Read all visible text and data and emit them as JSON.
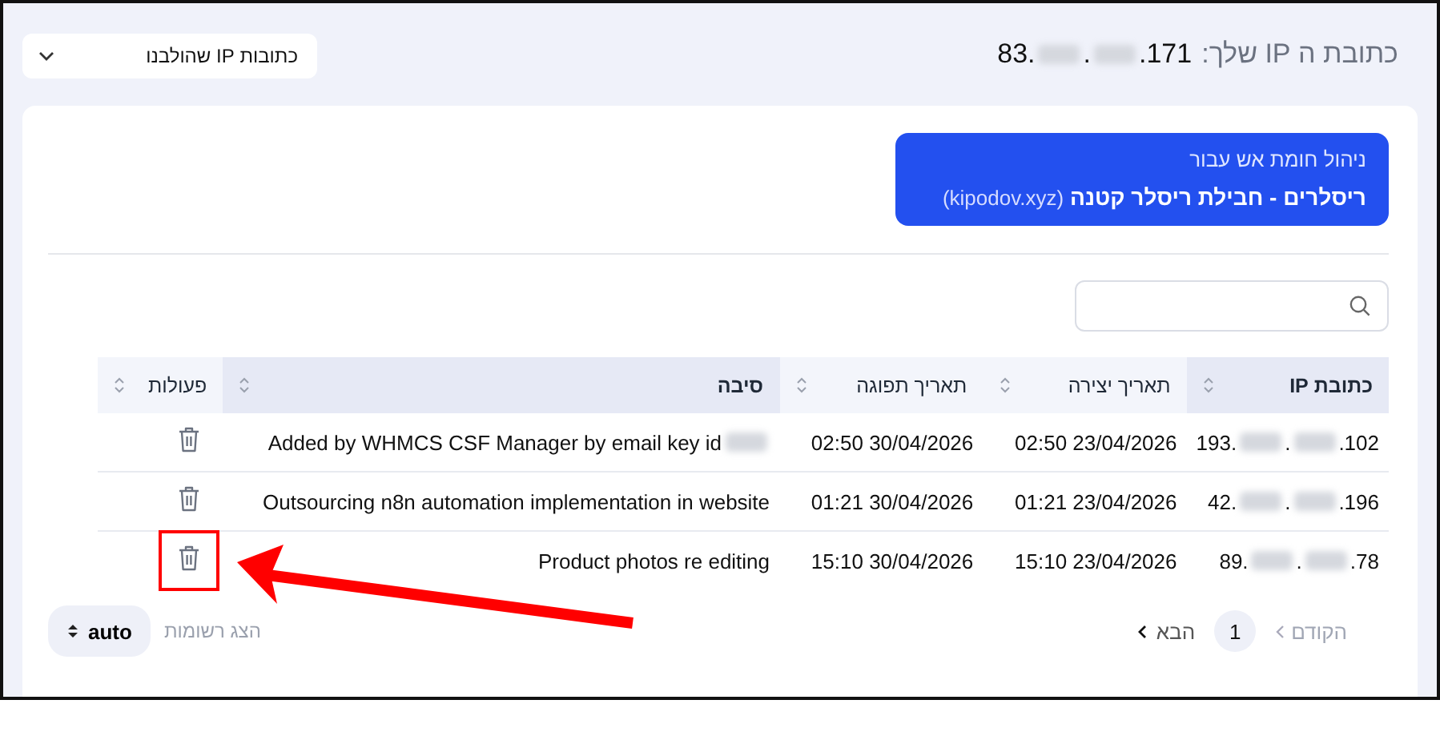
{
  "header": {
    "ip_label": "כתובת ה IP שלך:",
    "ip": {
      "start": "83.",
      "middle": ".",
      "end": ".171"
    },
    "dropdown": {
      "label": "כתובות IP שהולבנו"
    }
  },
  "banner": {
    "subtitle": "ניהול חומת אש עבור",
    "title": "ריסלרים - חבילת ריסלר קטנה",
    "domain": "(kipodov.xyz)"
  },
  "table": {
    "columns": [
      {
        "label": "כתובת IP",
        "highlighted": true
      },
      {
        "label": "תאריך יצירה",
        "highlighted": false
      },
      {
        "label": "תאריך תפוגה",
        "highlighted": false
      },
      {
        "label": "סיבה",
        "highlighted": true
      },
      {
        "label": "פעולות",
        "highlighted": false
      }
    ],
    "rows": [
      {
        "ip": {
          "start": "193.",
          "middle": ".",
          "end": ".102"
        },
        "created": "02:50 23/04/2026",
        "expires": "02:50 30/04/2026",
        "reason": [
          {
            "kind": "text",
            "text": "Added by WHMCS CSF Manager by email key id"
          },
          {
            "kind": "redacted"
          }
        ]
      },
      {
        "ip": {
          "start": "42.",
          "middle": ".",
          "end": ".196"
        },
        "created": "01:21 23/04/2026",
        "expires": "01:21 30/04/2026",
        "reason": [
          {
            "kind": "text",
            "text": "Outsourcing n8n automation implementation in website"
          }
        ]
      },
      {
        "ip": {
          "start": "89.",
          "middle": ".",
          "end": ".78"
        },
        "created": "15:10 23/04/2026",
        "expires": "15:10 30/04/2026",
        "reason": [
          {
            "kind": "text",
            "text": "Product photos re editing"
          }
        ]
      }
    ]
  },
  "pagination": {
    "previous": "הקודם",
    "pages": [
      {
        "label": "1",
        "selected": true
      }
    ],
    "next": "הבא",
    "page_size_label": "הצג רשומות",
    "page_size": "auto"
  },
  "annotation": {
    "kind": "arrow-box",
    "color": "#ff0000"
  }
}
